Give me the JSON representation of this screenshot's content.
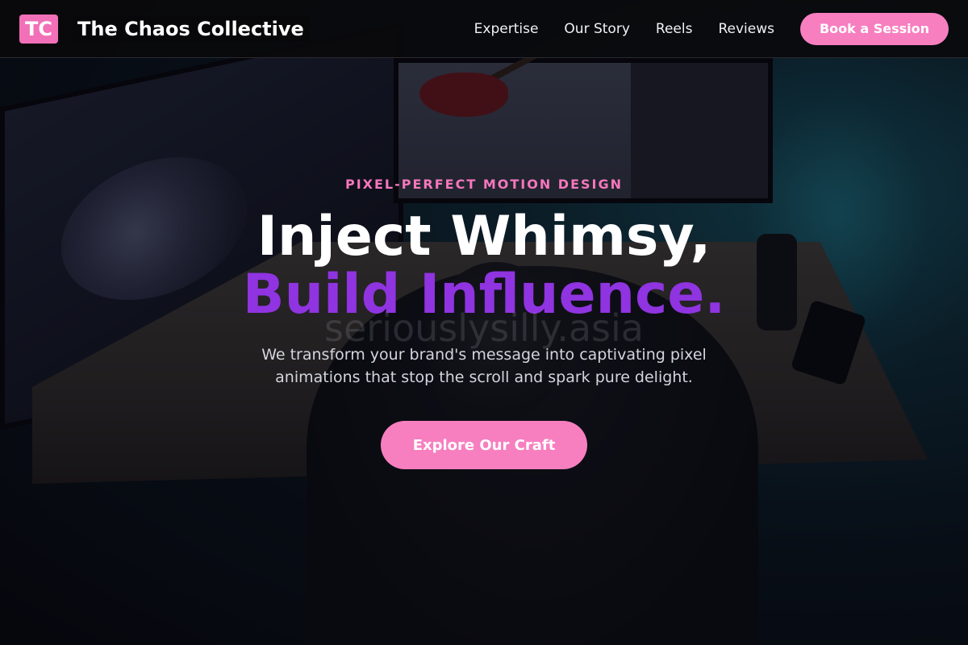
{
  "brand": {
    "logo_text": "TC",
    "name": "The Chaos Collective"
  },
  "nav": {
    "links": [
      "Expertise",
      "Our Story",
      "Reels",
      "Reviews"
    ],
    "cta_label": "Book a Session"
  },
  "hero": {
    "eyebrow": "PIXEL-PERFECT MOTION DESIGN",
    "headline_line1": "Inject Whimsy,",
    "headline_line2": "Build Influence.",
    "watermark": "seriouslysilly.asia",
    "subtitle": "We transform your brand's message into captivating pixel animations that stop the scroll and spark pure delight.",
    "cta_label": "Explore Our Craft"
  },
  "colors": {
    "accent_pink": "#f77fc0",
    "accent_purple": "#8f34e0",
    "header_bg": "#0a0a0c"
  }
}
